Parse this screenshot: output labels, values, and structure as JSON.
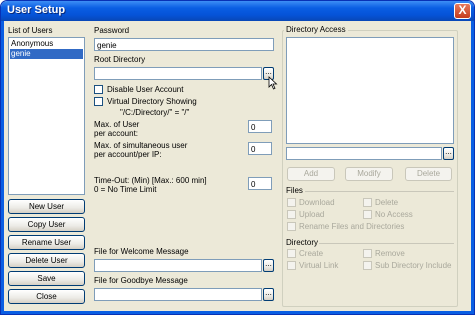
{
  "window": {
    "title": "User Setup",
    "close_glyph": "X"
  },
  "users": {
    "label": "List of Users",
    "items": [
      "Anonymous",
      "genie"
    ],
    "selected_index": 1
  },
  "buttons": {
    "new_user": "New User",
    "copy_user": "Copy User",
    "rename_user": "Rename User",
    "delete_user": "Delete User",
    "save": "Save",
    "close": "Close"
  },
  "form": {
    "password_label": "Password",
    "password_value": "genie",
    "root_dir_label": "Root Directory",
    "root_dir_value": "",
    "browse_glyph": "...",
    "disable_account_label": "Disable User Account",
    "virtual_dir_label": "Virtual Directory Showing",
    "virtual_dir_hint": "\"/C:/Directory/\" = \"/\"",
    "max_user_label_1": "Max. of User",
    "max_user_label_2": "per account:",
    "max_user_value": "0",
    "max_sim_label_1": "Max. of simultaneous user",
    "max_sim_label_2": "per account/per IP:",
    "max_sim_value": "0",
    "timeout_label_1": "Time-Out: (Min) [Max.: 600 min]",
    "timeout_label_2": "0 = No Time Limit",
    "timeout_value": "0",
    "welcome_label": "File for Welcome Message",
    "welcome_value": "",
    "goodbye_label": "File for Goodbye Message",
    "goodbye_value": ""
  },
  "directory_access": {
    "label": "Directory Access",
    "path_value": "",
    "add": "Add",
    "modify": "Modify",
    "delete": "Delete",
    "files_label": "Files",
    "download": "Download",
    "upload": "Upload",
    "delete_perm": "Delete",
    "no_access": "No Access",
    "rename": "Rename Files and Directories",
    "directory_label": "Directory",
    "create": "Create",
    "remove": "Remove",
    "virtual_link": "Virtual Link",
    "sub_dir_include": "Sub Directory Include"
  }
}
